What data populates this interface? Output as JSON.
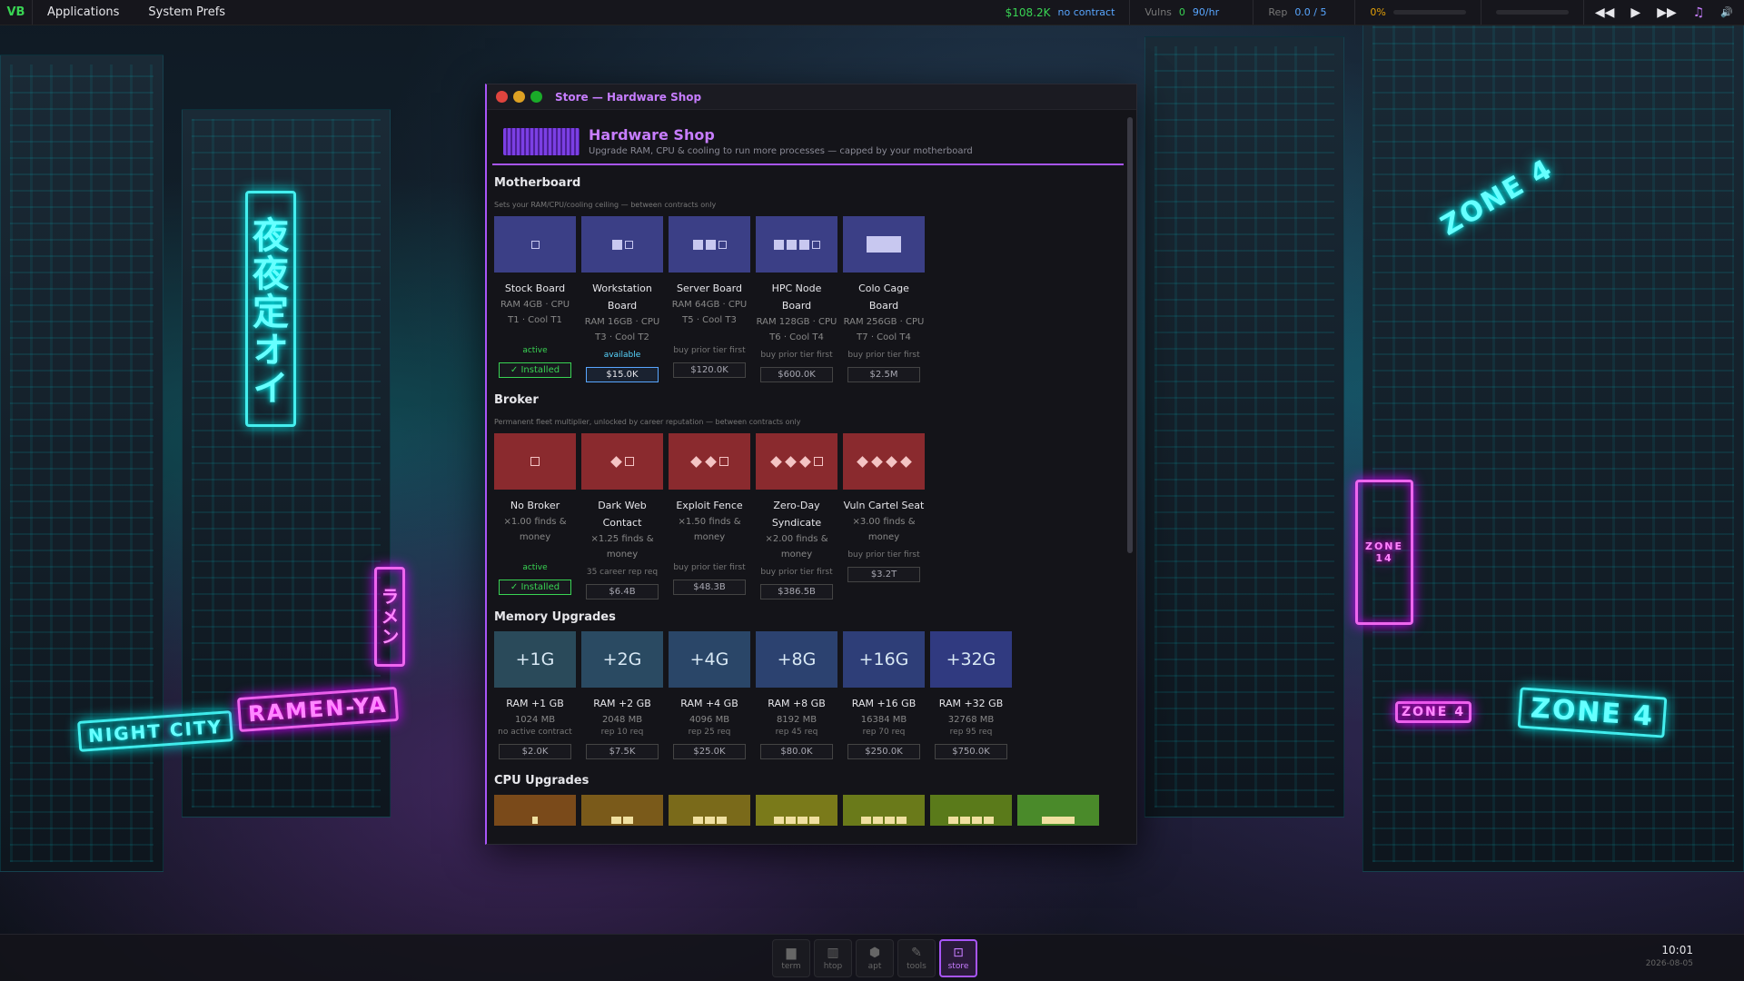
{
  "topbar": {
    "logo": "VB",
    "menu": [
      "Applications",
      "System Prefs"
    ],
    "money": "$108.2K",
    "contract": "no contract",
    "vulns_label": "Vulns",
    "vulns_value": "0",
    "vulns_rate": "90/hr",
    "rep_label": "Rep",
    "rep_value": "0.0 / 5",
    "progress": "0%",
    "progress_fraction": 0.0
  },
  "media": {
    "prev": "◀◀",
    "play": "▶",
    "next": "▶▶",
    "music": "♫",
    "volume": "🔊"
  },
  "window": {
    "title": "Store — Hardware Shop",
    "header_title": "Hardware Shop",
    "header_subtitle": "Upgrade RAM, CPU & cooling to run more processes — capped by your motherboard"
  },
  "motherboard": {
    "title": "Motherboard",
    "subtitle": "Sets your RAM/CPU/cooling ceiling — between contracts only",
    "items": [
      {
        "name": "Stock Board",
        "spec": "RAM 4GB · CPU T1 · Cool T1",
        "req": "active",
        "button": "✓ Installed"
      },
      {
        "name": "Workstation Board",
        "spec": "RAM 16GB · CPU T3 · Cool T2",
        "req": "available",
        "button": "$15.0K"
      },
      {
        "name": "Server Board",
        "spec": "RAM 64GB · CPU T5 · Cool T3",
        "req": "buy prior tier first",
        "button": "$120.0K"
      },
      {
        "name": "HPC Node Board",
        "spec": "RAM 128GB · CPU T6 · Cool T4",
        "req": "buy prior tier first",
        "button": "$600.0K"
      },
      {
        "name": "Colo Cage Board",
        "spec": "RAM 256GB · CPU T7 · Cool T4",
        "req": "buy prior tier first",
        "button": "$2.5M"
      }
    ]
  },
  "broker": {
    "title": "Broker",
    "subtitle": "Permanent fleet multiplier, unlocked by career reputation — between contracts only",
    "items": [
      {
        "name": "No Broker",
        "spec": "×1.00 finds & money",
        "req": "active",
        "button": "✓ Installed"
      },
      {
        "name": "Dark Web Contact",
        "spec": "×1.25 finds & money",
        "req": "35 career rep req",
        "button": "$6.4B"
      },
      {
        "name": "Exploit Fence",
        "spec": "×1.50 finds & money",
        "req": "buy prior tier first",
        "button": "$48.3B"
      },
      {
        "name": "Zero-Day Syndicate",
        "spec": "×2.00 finds & money",
        "req": "buy prior tier first",
        "button": "$386.5B"
      },
      {
        "name": "Vuln Cartel Seat",
        "spec": "×3.00 finds & money",
        "req": "buy prior tier first",
        "button": "$3.2T"
      }
    ]
  },
  "memory": {
    "title": "Memory Upgrades",
    "items": [
      {
        "tile": "+1G",
        "name": "RAM +1 GB",
        "spec": "1024 MB",
        "req": "no active contract",
        "button": "$2.0K",
        "color": "#2a4a5a"
      },
      {
        "tile": "+2G",
        "name": "RAM +2 GB",
        "spec": "2048 MB",
        "req": "rep 10 req",
        "button": "$7.5K",
        "color": "#2a4a62"
      },
      {
        "tile": "+4G",
        "name": "RAM +4 GB",
        "spec": "4096 MB",
        "req": "rep 25 req",
        "button": "$25.0K",
        "color": "#2a4668"
      },
      {
        "tile": "+8G",
        "name": "RAM +8 GB",
        "spec": "8192 MB",
        "req": "rep 45 req",
        "button": "$80.0K",
        "color": "#2c4270"
      },
      {
        "tile": "+16G",
        "name": "RAM +16 GB",
        "spec": "16384 MB",
        "req": "rep 70 req",
        "button": "$250.0K",
        "color": "#2e3e78"
      },
      {
        "tile": "+32G",
        "name": "RAM +32 GB",
        "spec": "32768 MB",
        "req": "rep 95 req",
        "button": "$750.0K",
        "color": "#303a80"
      }
    ]
  },
  "cpu": {
    "title": "CPU Upgrades",
    "colors": [
      "#7a4a1a",
      "#7a5a1a",
      "#7a6a1a",
      "#7a7a1a",
      "#6a7a1a",
      "#5a7a1a",
      "#4a8a2a"
    ]
  },
  "dock": [
    {
      "label": "term",
      "icon": "▆"
    },
    {
      "label": "htop",
      "icon": "▥"
    },
    {
      "label": "apt",
      "icon": "⬢"
    },
    {
      "label": "tools",
      "icon": "✎"
    },
    {
      "label": "store",
      "icon": "⊡"
    }
  ],
  "clock": {
    "time": "10:01",
    "date": "2026-08-05"
  },
  "signs": {
    "night_city": "NIGHT CITY",
    "ramen": "RAMEN-YA",
    "zone": "ZONE 4",
    "zone_small": "ZONE 4",
    "zone14": "ZONE 14",
    "kanji_big": "夜夜定オイ",
    "ramen_vertical": "ラメン"
  }
}
